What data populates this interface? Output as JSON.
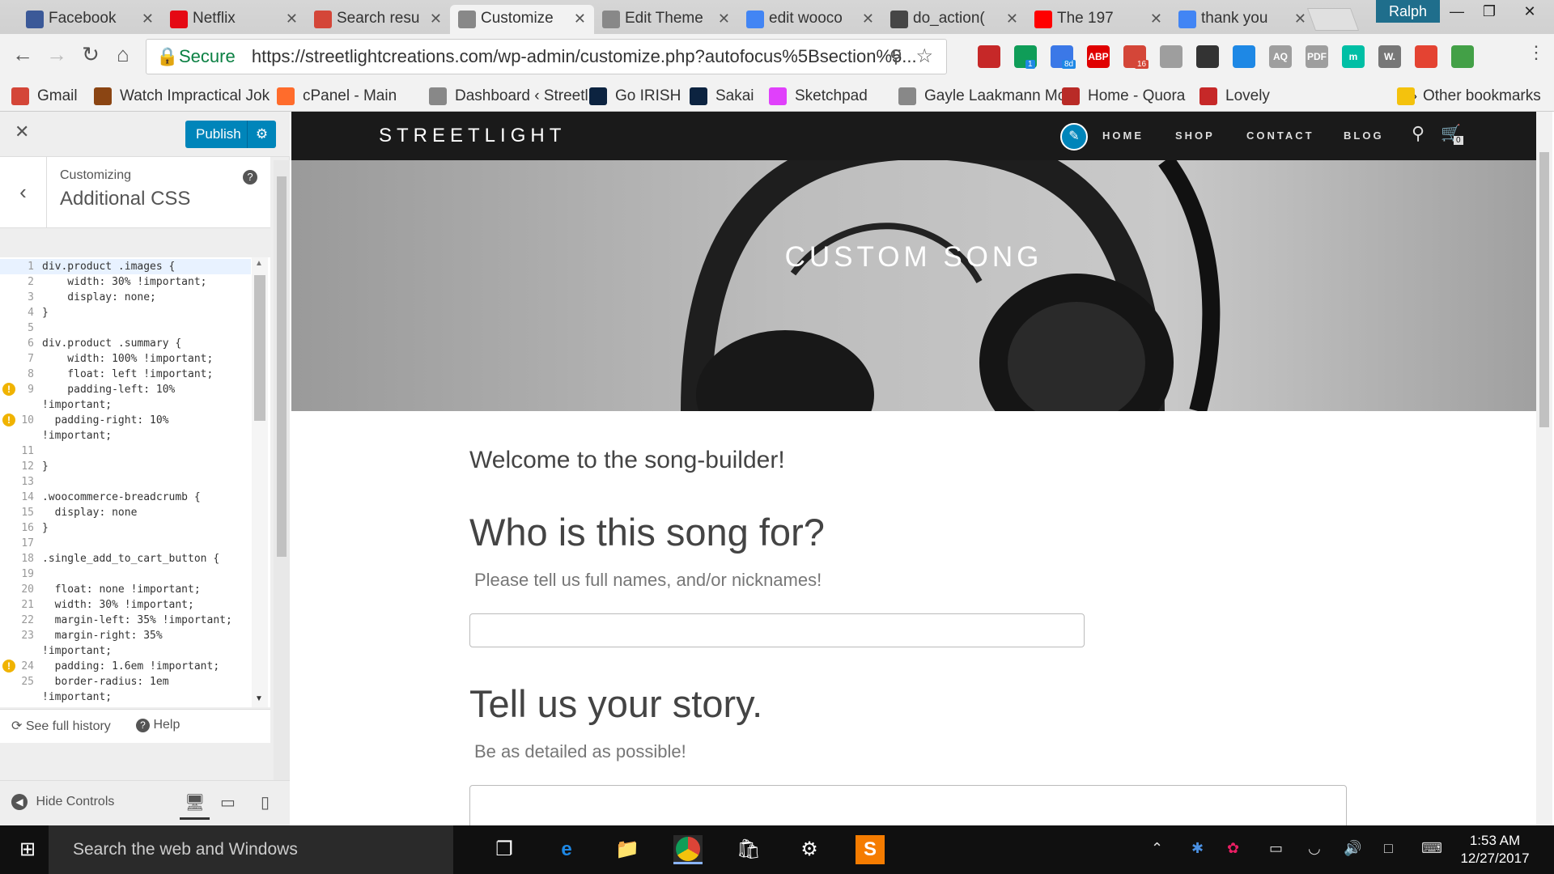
{
  "browser": {
    "tabs": [
      {
        "label": "Facebook",
        "icon": "facebook-icon",
        "color": "#3b5998"
      },
      {
        "label": "Netflix",
        "icon": "netflix-icon",
        "color": "#e50914"
      },
      {
        "label": "Search resu",
        "icon": "gmail-icon",
        "color": "#d44638"
      },
      {
        "label": "Customize",
        "icon": "page-icon",
        "color": "#888888",
        "active": true
      },
      {
        "label": "Edit Theme",
        "icon": "page-icon",
        "color": "#888888"
      },
      {
        "label": "edit wooco",
        "icon": "google-icon",
        "color": "#4285f4"
      },
      {
        "label": "do_action(",
        "icon": "wordpress-icon",
        "color": "#464646"
      },
      {
        "label": "The 197",
        "icon": "youtube-icon",
        "color": "#ff0000"
      },
      {
        "label": "thank you",
        "icon": "google-icon",
        "color": "#4285f4"
      }
    ],
    "profile_name": "Ralph",
    "address": {
      "secure_label": "Secure",
      "url": "https://streetlightcreations.com/wp-admin/customize.php?autofocus%5Bsection%5..."
    },
    "bookmarks": [
      {
        "label": "Gmail",
        "color": "#d44638"
      },
      {
        "label": "Watch Impractical Jok",
        "color": "#8b4513"
      },
      {
        "label": "cPanel - Main",
        "color": "#ff6c2c"
      },
      {
        "label": "Dashboard ‹ Streetlig",
        "color": "#888888"
      },
      {
        "label": "Go IRISH",
        "color": "#0c2340"
      },
      {
        "label": "Sakai",
        "color": "#0c2340"
      },
      {
        "label": "Sketchpad",
        "color": "#e040fb"
      },
      {
        "label": "Gayle Laakmann McD",
        "color": "#888888"
      },
      {
        "label": "Home - Quora",
        "color": "#b92b27"
      },
      {
        "label": "Lovely",
        "color": "#c62828"
      }
    ],
    "bookmarks_more": "»",
    "other_bookmarks": "Other bookmarks",
    "extensions": [
      {
        "name": "bookmark-ext-icon",
        "color": "#c62828"
      },
      {
        "name": "hangouts-icon",
        "color": "#0f9d58",
        "badge": "1"
      },
      {
        "name": "chat-ext-icon",
        "color": "#3b78e7",
        "badge": "8d"
      },
      {
        "name": "adblock-icon",
        "color": "#e00000",
        "label": "ABP"
      },
      {
        "name": "gmail-ext-icon",
        "color": "#d44638",
        "badge": "16"
      },
      {
        "name": "clipboard-ext-icon",
        "color": "#9e9e9e"
      },
      {
        "name": "film-ext-icon",
        "color": "#333333"
      },
      {
        "name": "m-ext-icon",
        "color": "#1e88e5"
      },
      {
        "name": "aq-ext-icon",
        "color": "#9e9e9e",
        "label": "AQ"
      },
      {
        "name": "pdf-ext-icon",
        "color": "#9e9e9e",
        "label": "PDF"
      },
      {
        "name": "m-circle-ext-icon",
        "color": "#00bfa5",
        "label": "m"
      },
      {
        "name": "w-ext-icon",
        "color": "#777777",
        "label": "W."
      },
      {
        "name": "todoist-ext-icon",
        "color": "#e44332"
      },
      {
        "name": "frog-ext-icon",
        "color": "#43a047"
      }
    ]
  },
  "customizer": {
    "publish_label": "Publish",
    "customizing_label": "Customizing",
    "section_title": "Additional CSS",
    "css_lines": [
      {
        "n": "1",
        "text": "div.product .images {"
      },
      {
        "n": "2",
        "text": "    width: 30% !important;"
      },
      {
        "n": "3",
        "text": "    display: none;"
      },
      {
        "n": "4",
        "text": "}"
      },
      {
        "n": "5",
        "text": ""
      },
      {
        "n": "6",
        "text": "div.product .summary {"
      },
      {
        "n": "7",
        "text": "    width: 100% !important;"
      },
      {
        "n": "8",
        "text": "    float: left !important;"
      },
      {
        "n": "9",
        "text": "    padding-left: 10%",
        "warn": true
      },
      {
        "n": "",
        "text": "!important;"
      },
      {
        "n": "10",
        "text": "  padding-right: 10%",
        "warn": true
      },
      {
        "n": "",
        "text": "!important;"
      },
      {
        "n": "11",
        "text": ""
      },
      {
        "n": "12",
        "text": "}"
      },
      {
        "n": "13",
        "text": ""
      },
      {
        "n": "14",
        "text": ".woocommerce-breadcrumb {"
      },
      {
        "n": "15",
        "text": "  display: none"
      },
      {
        "n": "16",
        "text": "}"
      },
      {
        "n": "17",
        "text": ""
      },
      {
        "n": "18",
        "text": ".single_add_to_cart_button {"
      },
      {
        "n": "19",
        "text": ""
      },
      {
        "n": "20",
        "text": "  float: none !important;"
      },
      {
        "n": "21",
        "text": "  width: 30% !important;"
      },
      {
        "n": "22",
        "text": "  margin-left: 35% !important;"
      },
      {
        "n": "23",
        "text": "  margin-right: 35%"
      },
      {
        "n": "",
        "text": "!important;"
      },
      {
        "n": "24",
        "text": "  padding: 1.6em !important;",
        "warn": true
      },
      {
        "n": "25",
        "text": "  border-radius: 1em"
      },
      {
        "n": "",
        "text": "!important;"
      }
    ],
    "history_label": "See full history",
    "help_label": "Help",
    "hide_controls_label": "Hide Controls"
  },
  "site": {
    "brand": "STREETLIGHT",
    "menu": [
      "HOME",
      "SHOP",
      "CONTACT",
      "BLOG"
    ],
    "cart_count": "0",
    "hero_title": "CUSTOM SONG",
    "welcome": "Welcome to the song-builder!",
    "q1_title": "Who is this song for?",
    "q1_sub": "Please tell us full names, and/or nicknames!",
    "q2_title": "Tell us your story.",
    "q2_sub": "Be as detailed as possible!"
  },
  "taskbar": {
    "search_placeholder": "Search the web and Windows",
    "time": "1:53 AM",
    "date": "12/27/2017"
  }
}
